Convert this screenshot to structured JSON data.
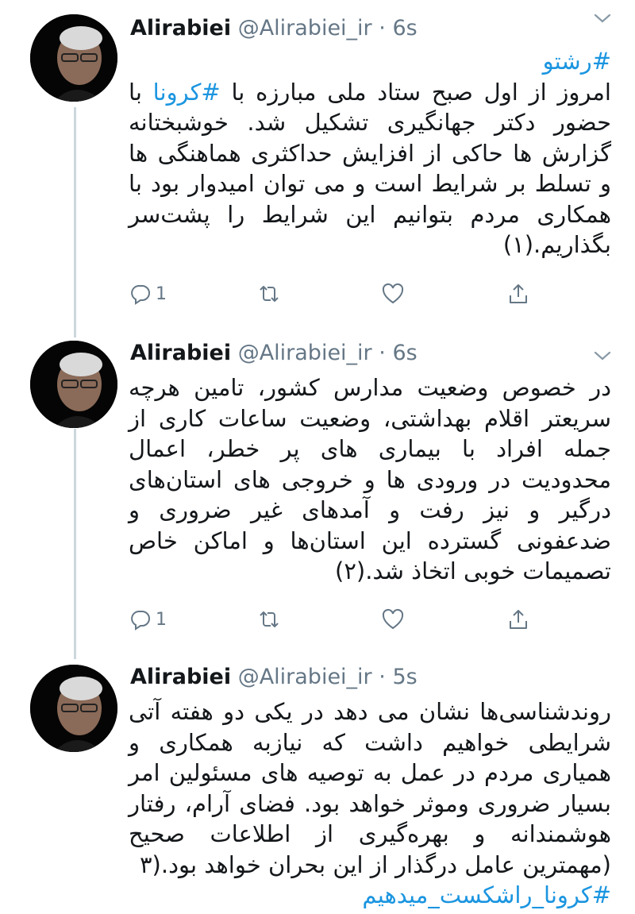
{
  "tweets": [
    {
      "display_name": "Alirabiei",
      "handle": "@Alirabiei_ir",
      "separator": "·",
      "time": "6s",
      "hashtag_top": "#رشتو",
      "lines": [
        [
          "امروز از اول صبح ستاد ملی مبارزه با ",
          "#کرونا",
          " با"
        ],
        [
          "حضور دکتر جهانگیری تشکیل شد. خوشبختانه"
        ],
        [
          "گزارش ها حاکی از افزایش حداکثری هماهنگی ها و"
        ],
        [
          "تسلط بر شرایط است و می توان امیدوار بود با"
        ],
        [
          "همکاری مردم بتوانیم این شرایط را پشت‌سر"
        ],
        [
          "بگذاریم.(۱)"
        ]
      ],
      "reply_count": "1"
    },
    {
      "display_name": "Alirabiei",
      "handle": "@Alirabiei_ir",
      "separator": "·",
      "time": "6s",
      "lines": [
        [
          "در خصوص وضعیت مدارس کشور، تامین هرچه"
        ],
        [
          "سریعتر اقلام بهداشتی، وضعیت ساعات کاری از"
        ],
        [
          "جمله افراد با بیماری های پر خطر، اعمال"
        ],
        [
          "محدودیت در ورودی ها و خروجی های استان‌های"
        ],
        [
          "درگیر و نیز رفت و آمدهای غیر ضروری و"
        ],
        [
          "ضدعفونی گسترده این استان‌ها و اماکن خاص"
        ],
        [
          "تصمیمات خوبی اتخاذ شد.(۲)"
        ]
      ],
      "reply_count": "1"
    },
    {
      "display_name": "Alirabiei",
      "handle": "@Alirabiei_ir",
      "separator": "·",
      "time": "5s",
      "lines": [
        [
          "روندشناسی‌ها نشان می دهد در یکی دو هفته آتی"
        ],
        [
          "شرایطی خواهیم داشت که نیازبه همکاری و"
        ],
        [
          "همیاری مردم در عمل به توصیه های مسئولین امر"
        ],
        [
          "بسیار ضروری وموثر خواهد بود. فضای آرام، رفتار"
        ],
        [
          "هوشمندانه و بهره‌گیری از اطلاعات صحیح"
        ],
        [
          "(مهمترین عامل درگذار از این بحران خواهد بود.(۳"
        ]
      ],
      "hashtag_bottom": "#کرونا_راشکست_میدهیم"
    }
  ],
  "icons": [
    "reply-icon",
    "retweet-icon",
    "like-icon",
    "share-icon",
    "chevron-down-icon"
  ],
  "colors": {
    "link": "#1b95e0",
    "muted": "#657786",
    "thread_line": "#ccd6dd"
  }
}
